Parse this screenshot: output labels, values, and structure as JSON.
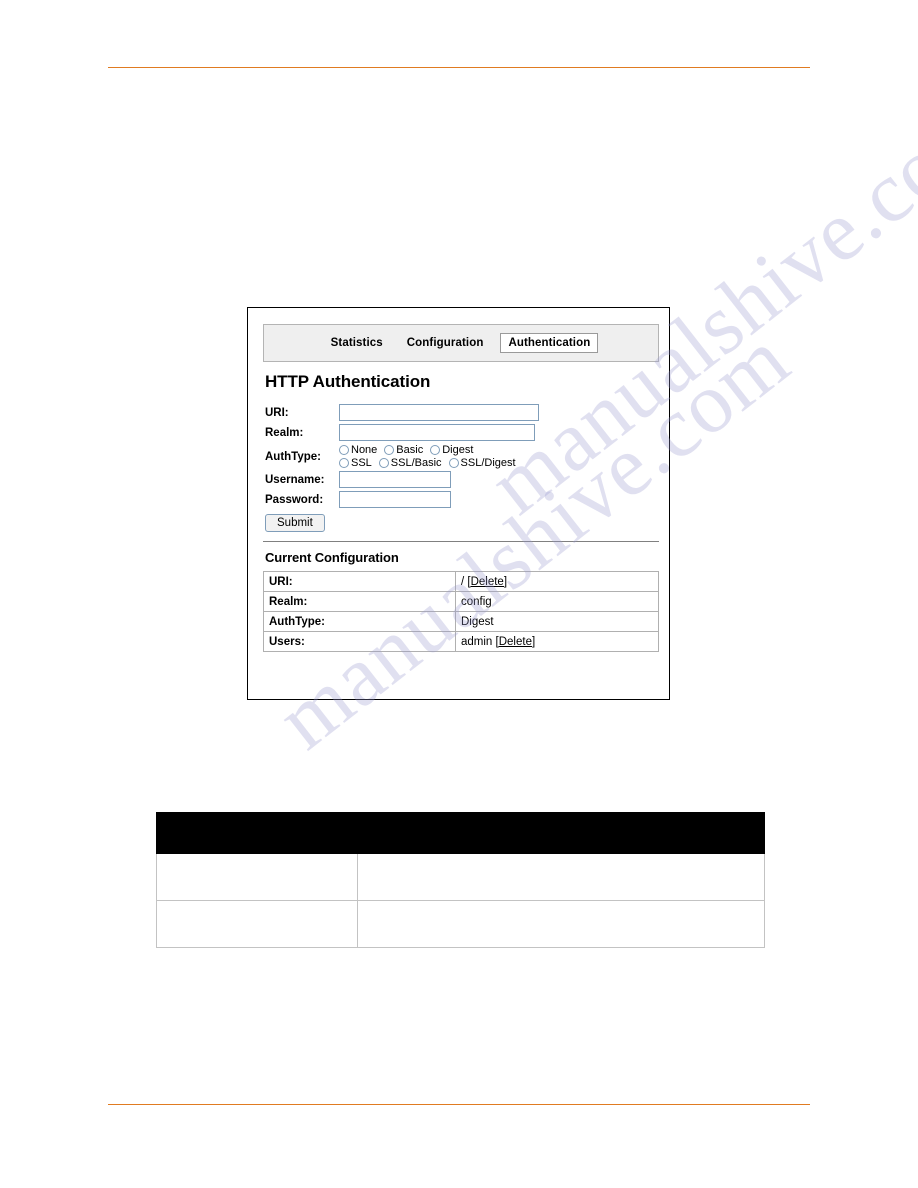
{
  "document": {
    "watermark_lines": [
      "manualshive.com",
      "manualshive.com"
    ]
  },
  "figure": {
    "tabs": [
      {
        "label": "Statistics",
        "active": false
      },
      {
        "label": "Configuration",
        "active": false
      },
      {
        "label": "Authentication",
        "active": true
      }
    ],
    "page_title": "HTTP Authentication",
    "form": {
      "uri": {
        "label": "URI:",
        "value": "",
        "placeholder": ""
      },
      "realm": {
        "label": "Realm:",
        "value": "",
        "placeholder": ""
      },
      "authtype": {
        "label": "AuthType:",
        "options_row1": [
          {
            "label": "None",
            "selected": false
          },
          {
            "label": "Basic",
            "selected": false
          },
          {
            "label": "Digest",
            "selected": false
          }
        ],
        "options_row2": [
          {
            "label": "SSL",
            "selected": false
          },
          {
            "label": "SSL/Basic",
            "selected": false
          },
          {
            "label": "SSL/Digest",
            "selected": false
          }
        ]
      },
      "username": {
        "label": "Username:",
        "value": "",
        "placeholder": ""
      },
      "password": {
        "label": "Password:",
        "value": "",
        "placeholder": ""
      },
      "submit_label": "Submit"
    },
    "current_configuration": {
      "section_title": "Current Configuration",
      "rows": [
        {
          "key": "URI:",
          "value": "/ ",
          "link": "[Delete]"
        },
        {
          "key": "Realm:",
          "value": "config",
          "link": ""
        },
        {
          "key": "AuthType:",
          "value": "Digest",
          "link": ""
        },
        {
          "key": "Users:",
          "value": "admin ",
          "link": "[Delete]"
        }
      ]
    }
  },
  "bottom_table": {
    "header": [
      "",
      ""
    ],
    "rows": [
      [
        "",
        ""
      ],
      [
        "",
        ""
      ]
    ]
  },
  "colors": {
    "rule": "#E07B21",
    "input_border": "#7f9db9",
    "tabbar_bg": "#efefef",
    "table_header_bg": "#000000"
  }
}
